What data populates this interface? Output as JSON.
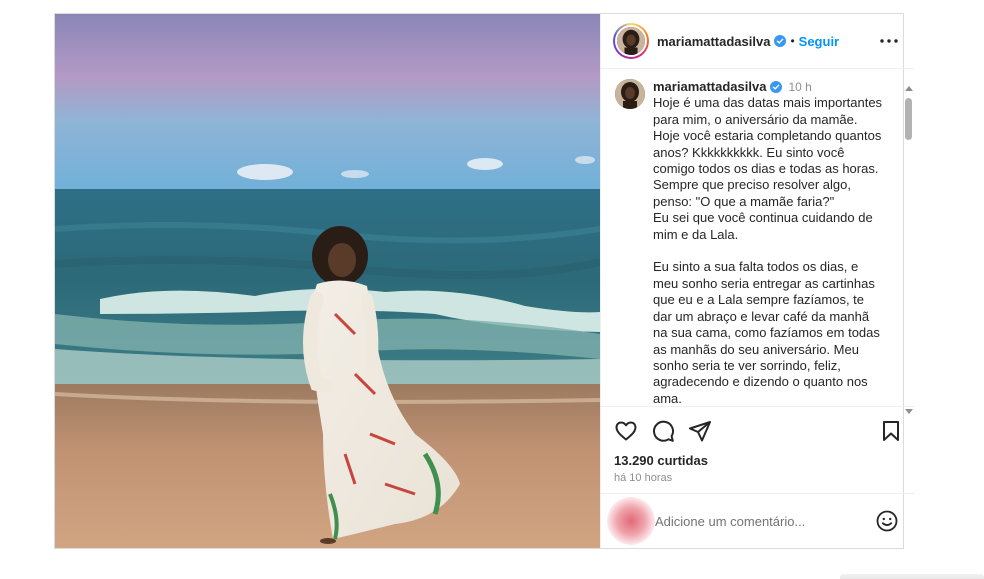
{
  "post": {
    "username": "mariamattadasilva",
    "follow_label": "Seguir",
    "dot": "•",
    "caption": {
      "username": "mariamattadasilva",
      "time": "10 h",
      "text": "Hoje é uma das datas mais importantes para mim, o aniversário da mamãe. Hoje você estaria completando quantos anos? Kkkkkkkkkk. Eu sinto você comigo todos os dias e todas as horas. Sempre que preciso resolver algo, penso: \"O que a mamãe faria?\"\nEu sei que você continua cuidando de mim e da Lala.\n\nEu sinto a sua falta todos os dias, e meu sonho seria entregar as cartinhas que eu e a Lala sempre fazíamos, te dar um abraço e levar café da manhã na sua cama, como fazíamos em todas as manhãs do seu aniversário. Meu sonho seria te ver sorrindo, feliz, agradecendo e dizendo o quanto nos ama."
    },
    "likes": "13.290 curtidas",
    "posted_ago": "há 10 horas",
    "comment_placeholder": "Adicione um comentário...",
    "icons": {
      "verified": "verified-badge-icon",
      "more": "more-options-icon",
      "like": "heart-icon",
      "comment": "comment-bubble-icon",
      "share": "paper-plane-icon",
      "save": "bookmark-icon",
      "emoji": "emoji-icon"
    },
    "colors": {
      "link": "#0095f6",
      "verified": "#3897f0",
      "muted": "#8e8e8e"
    }
  }
}
